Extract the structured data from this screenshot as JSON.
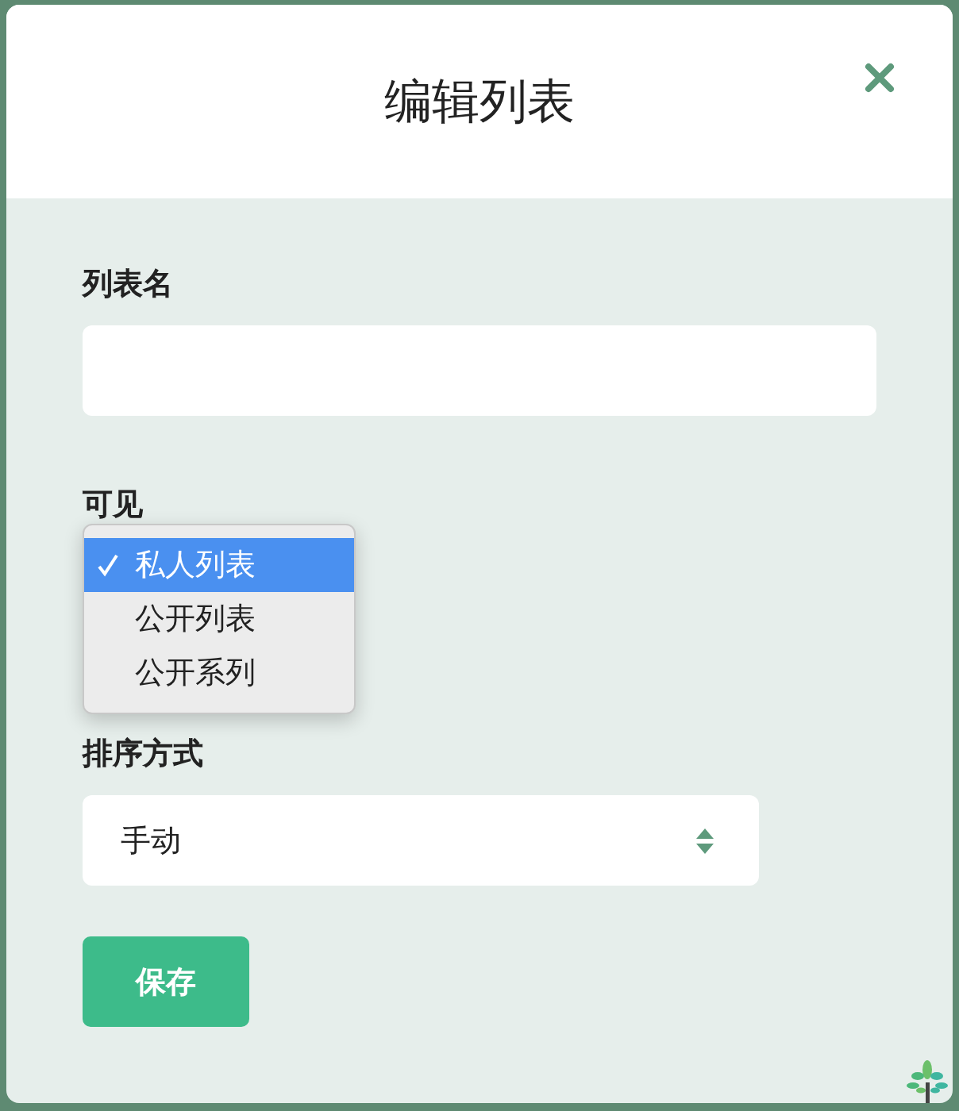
{
  "dialog": {
    "title": "编辑列表"
  },
  "fields": [
    {
      "kind": "text",
      "label": "列表名"
    },
    {
      "kind": "dropdown",
      "label": "可见",
      "options": [
        {
          "label": "私人列表",
          "selected": true
        },
        {
          "label": "公开列表",
          "selected": false
        },
        {
          "label": "公开系列",
          "selected": false
        }
      ]
    },
    {
      "kind": "select",
      "label": "排序方式",
      "value": "手动"
    }
  ],
  "buttons": [
    {
      "label": "保存"
    }
  ]
}
